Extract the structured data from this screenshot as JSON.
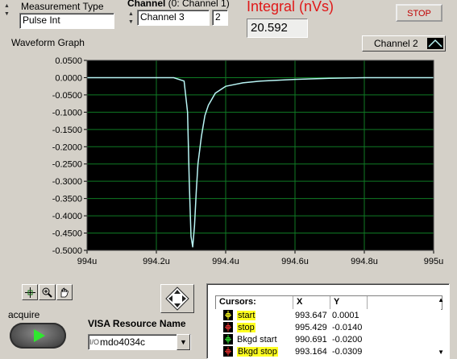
{
  "controls": {
    "measurement_type_label": "Measurement Type",
    "measurement_type_value": "Pulse Int",
    "channel_label_bold": "Channel",
    "channel_label_suffix": " (0: Channel 1)",
    "channel_value": "Channel 3",
    "channel_index": "2",
    "integral_label": "Integral (nVs)",
    "integral_value": "20.592",
    "stop_label": "STOP",
    "acquire_label": "acquire",
    "visa_label": "VISA Resource Name",
    "visa_io_glyph": "I/O",
    "visa_value": "mdo4034c"
  },
  "graph": {
    "title": "Waveform Graph",
    "legend_label": "Channel 2"
  },
  "colors": {
    "plot_background": "#000000",
    "trace": "#b8f4f4",
    "grid": "#0f7a24",
    "integral_label": "#e01818",
    "acquire_arrow": "#2ee82e",
    "cursor_highlight": "#ffff20"
  },
  "chart_data": {
    "type": "line",
    "title": "",
    "xlabel": "",
    "ylabel": "",
    "xlim": [
      994.0,
      995.0
    ],
    "ylim": [
      -0.5,
      0.05
    ],
    "x_unit": "u",
    "xticks": [
      "994u",
      "994.2u",
      "994.4u",
      "994.6u",
      "994.8u",
      "995u"
    ],
    "yticks": [
      "0.0500",
      "0.0000",
      "-0.0500",
      "-0.1000",
      "-0.1500",
      "-0.2000",
      "-0.2500",
      "-0.3000",
      "-0.3500",
      "-0.4000",
      "-0.4500",
      "-0.5000"
    ],
    "grid": true,
    "series": [
      {
        "name": "Channel 2",
        "x": [
          994.0,
          994.05,
          994.1,
          994.15,
          994.2,
          994.25,
          994.28,
          994.29,
          994.295,
          994.3,
          994.305,
          994.31,
          994.315,
          994.32,
          994.33,
          994.34,
          994.35,
          994.37,
          994.4,
          994.45,
          994.5,
          994.6,
          994.7,
          994.8,
          994.9,
          995.0
        ],
        "y": [
          0.0,
          0.0,
          0.0,
          0.0,
          0.0,
          0.0,
          -0.01,
          -0.1,
          -0.3,
          -0.46,
          -0.49,
          -0.43,
          -0.33,
          -0.25,
          -0.17,
          -0.11,
          -0.08,
          -0.045,
          -0.025,
          -0.015,
          -0.01,
          -0.005,
          -0.002,
          0.0,
          0.0,
          0.0
        ]
      }
    ]
  },
  "tools": [
    {
      "icon": "crosshair-cursor-tool-icon"
    },
    {
      "icon": "zoom-tool-icon"
    },
    {
      "icon": "pan-hand-tool-icon"
    }
  ],
  "cursors": {
    "title": "Cursors:",
    "columns": [
      "X",
      "Y"
    ],
    "rows": [
      {
        "name": "start",
        "x": "993.647",
        "y": "0.0001",
        "highlighted": true,
        "icon_color": "#ffff20"
      },
      {
        "name": "stop",
        "x": "995.429",
        "y": "-0.0140",
        "highlighted": true,
        "icon_color": "#e83030"
      },
      {
        "name": "Bkgd start",
        "x": "990.691",
        "y": "-0.0200",
        "highlighted": false,
        "icon_color": "#30e030"
      },
      {
        "name": "Bkgd stop",
        "x": "993.164",
        "y": "-0.0309",
        "highlighted": true,
        "icon_color": "#e83030"
      }
    ]
  }
}
